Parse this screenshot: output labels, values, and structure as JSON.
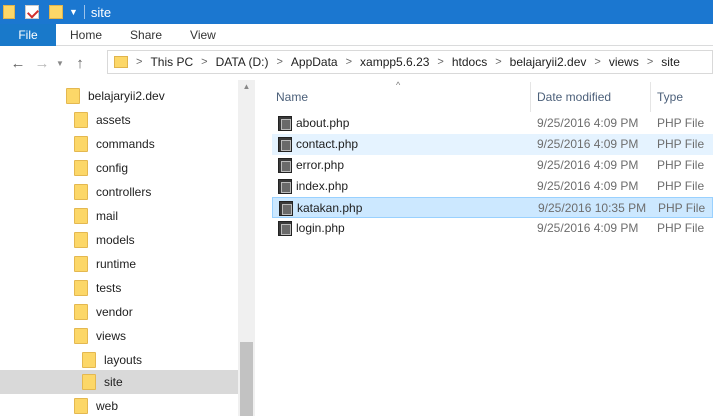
{
  "window": {
    "title": "site"
  },
  "ribbon": {
    "tabs": [
      "File",
      "Home",
      "Share",
      "View"
    ]
  },
  "address": {
    "crumbs": [
      "This PC",
      "DATA (D:)",
      "AppData",
      "xampp5.6.23",
      "htdocs",
      "belajaryii2.dev",
      "views",
      "site"
    ]
  },
  "nav_tree": [
    {
      "label": "belajaryii2.dev",
      "selected": false
    },
    {
      "label": "assets",
      "selected": false
    },
    {
      "label": "commands",
      "selected": false
    },
    {
      "label": "config",
      "selected": false
    },
    {
      "label": "controllers",
      "selected": false
    },
    {
      "label": "mail",
      "selected": false
    },
    {
      "label": "models",
      "selected": false
    },
    {
      "label": "runtime",
      "selected": false
    },
    {
      "label": "tests",
      "selected": false
    },
    {
      "label": "vendor",
      "selected": false
    },
    {
      "label": "views",
      "selected": false
    },
    {
      "label": "layouts",
      "selected": false
    },
    {
      "label": "site",
      "selected": true
    },
    {
      "label": "web",
      "selected": false
    }
  ],
  "columns": {
    "name": "Name",
    "date": "Date modified",
    "type": "Type"
  },
  "files": [
    {
      "name": "about.php",
      "date": "9/25/2016 4:09 PM",
      "type": "PHP File",
      "state": ""
    },
    {
      "name": "contact.php",
      "date": "9/25/2016 4:09 PM",
      "type": "PHP File",
      "state": "hover"
    },
    {
      "name": "error.php",
      "date": "9/25/2016 4:09 PM",
      "type": "PHP File",
      "state": ""
    },
    {
      "name": "index.php",
      "date": "9/25/2016 4:09 PM",
      "type": "PHP File",
      "state": ""
    },
    {
      "name": "katakan.php",
      "date": "9/25/2016 10:35 PM",
      "type": "PHP File",
      "state": "selected"
    },
    {
      "name": "login.php",
      "date": "9/25/2016 4:09 PM",
      "type": "PHP File",
      "state": ""
    }
  ]
}
